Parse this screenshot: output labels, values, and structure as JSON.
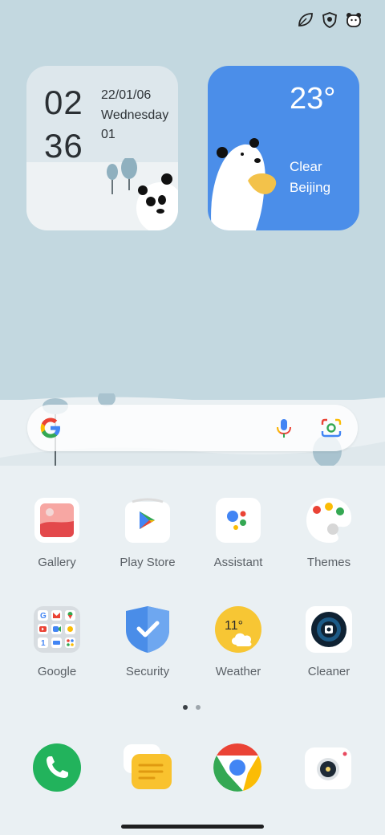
{
  "status_icons": [
    "leaf-icon",
    "shield-icon",
    "bear-icon"
  ],
  "clock_widget": {
    "hours": "02",
    "minutes": "36",
    "date": "22/01/06",
    "weekday": "Wednesday",
    "extra": "01"
  },
  "weather_widget": {
    "temperature": "23°",
    "condition": "Clear",
    "city": "Beijing"
  },
  "search_bar": {
    "icons": [
      "google-g-icon",
      "microphone-icon",
      "lens-camera-icon"
    ]
  },
  "apps_row1": [
    {
      "label": "Gallery",
      "icon": "gallery-icon"
    },
    {
      "label": "Play Store",
      "icon": "play-store-icon"
    },
    {
      "label": "Assistant",
      "icon": "assistant-icon"
    },
    {
      "label": "Themes",
      "icon": "themes-palette-icon"
    }
  ],
  "apps_row2": [
    {
      "label": "Google",
      "icon": "google-folder-icon"
    },
    {
      "label": "Security",
      "icon": "security-shield-icon"
    },
    {
      "label": "Weather",
      "icon": "weather-icon",
      "badge": "11°"
    },
    {
      "label": "Cleaner",
      "icon": "cleaner-icon"
    }
  ],
  "page_indicator": {
    "pages": 2,
    "current": 1
  },
  "dock": [
    {
      "icon": "phone-icon"
    },
    {
      "icon": "messages-icon"
    },
    {
      "icon": "chrome-icon"
    },
    {
      "icon": "camera-icon"
    }
  ],
  "colors": {
    "sky": "#c3d8e0",
    "snow": "#eaf0f3",
    "weather_blue": "#4b8ee9"
  }
}
